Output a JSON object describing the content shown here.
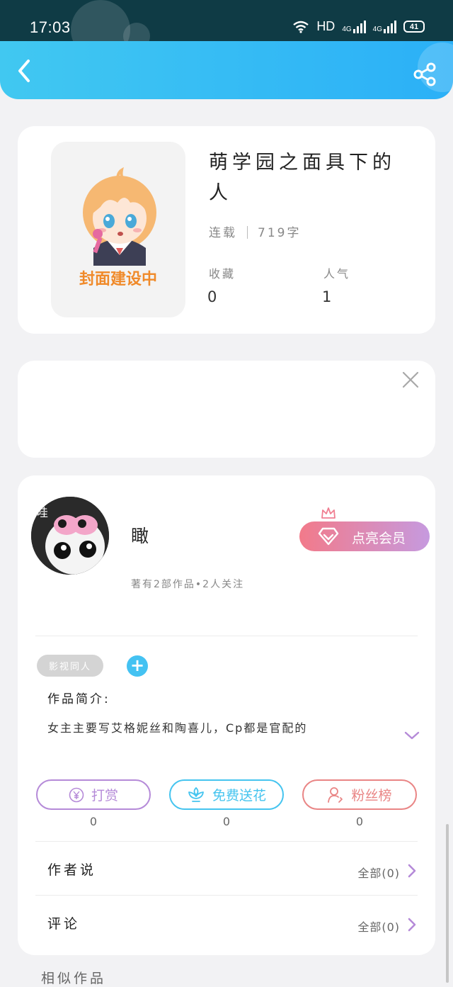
{
  "status_bar": {
    "time": "17:03",
    "network": "HD",
    "signal1": "4G",
    "signal2": "4G",
    "battery": "41"
  },
  "header": {
    "back_icon": "chevron-left-icon",
    "share_icon": "share-icon"
  },
  "book": {
    "cover_text": "封面建设中",
    "title": "萌学园之面具下的人",
    "status": "连载",
    "word_count": "719字",
    "favorites_label": "收藏",
    "favorites_value": "0",
    "popularity_label": "人气",
    "popularity_value": "1"
  },
  "ad": {
    "close_icon": "close-icon"
  },
  "author": {
    "name": "瞰",
    "summary": "著有2部作品•2人关注",
    "vip_label": "点亮会员",
    "tag": "影视同人",
    "add_tag_label": "+",
    "intro_label": "作品简介:",
    "intro_text": "女主主要写艾格妮丝和陶喜儿，Cp都是官配的"
  },
  "actions": [
    {
      "label": "打赏",
      "count": "0",
      "icon": "yen-icon",
      "color": "#b58ad8"
    },
    {
      "label": "免费送花",
      "count": "0",
      "icon": "flower-icon",
      "color": "#45c4ef"
    },
    {
      "label": "粉丝榜",
      "count": "0",
      "icon": "fan-icon",
      "color": "#e98585"
    }
  ],
  "rows": [
    {
      "label": "作者说",
      "right": "全部(0)"
    },
    {
      "label": "评论",
      "right": "全部(0)"
    }
  ],
  "similar_label": "相似作品",
  "colors": {
    "header_start": "#41c8f1",
    "header_end": "#2bb0f7",
    "accent_purple": "#b58ad8",
    "accent_blue": "#45c4ef",
    "accent_red": "#e98585"
  }
}
